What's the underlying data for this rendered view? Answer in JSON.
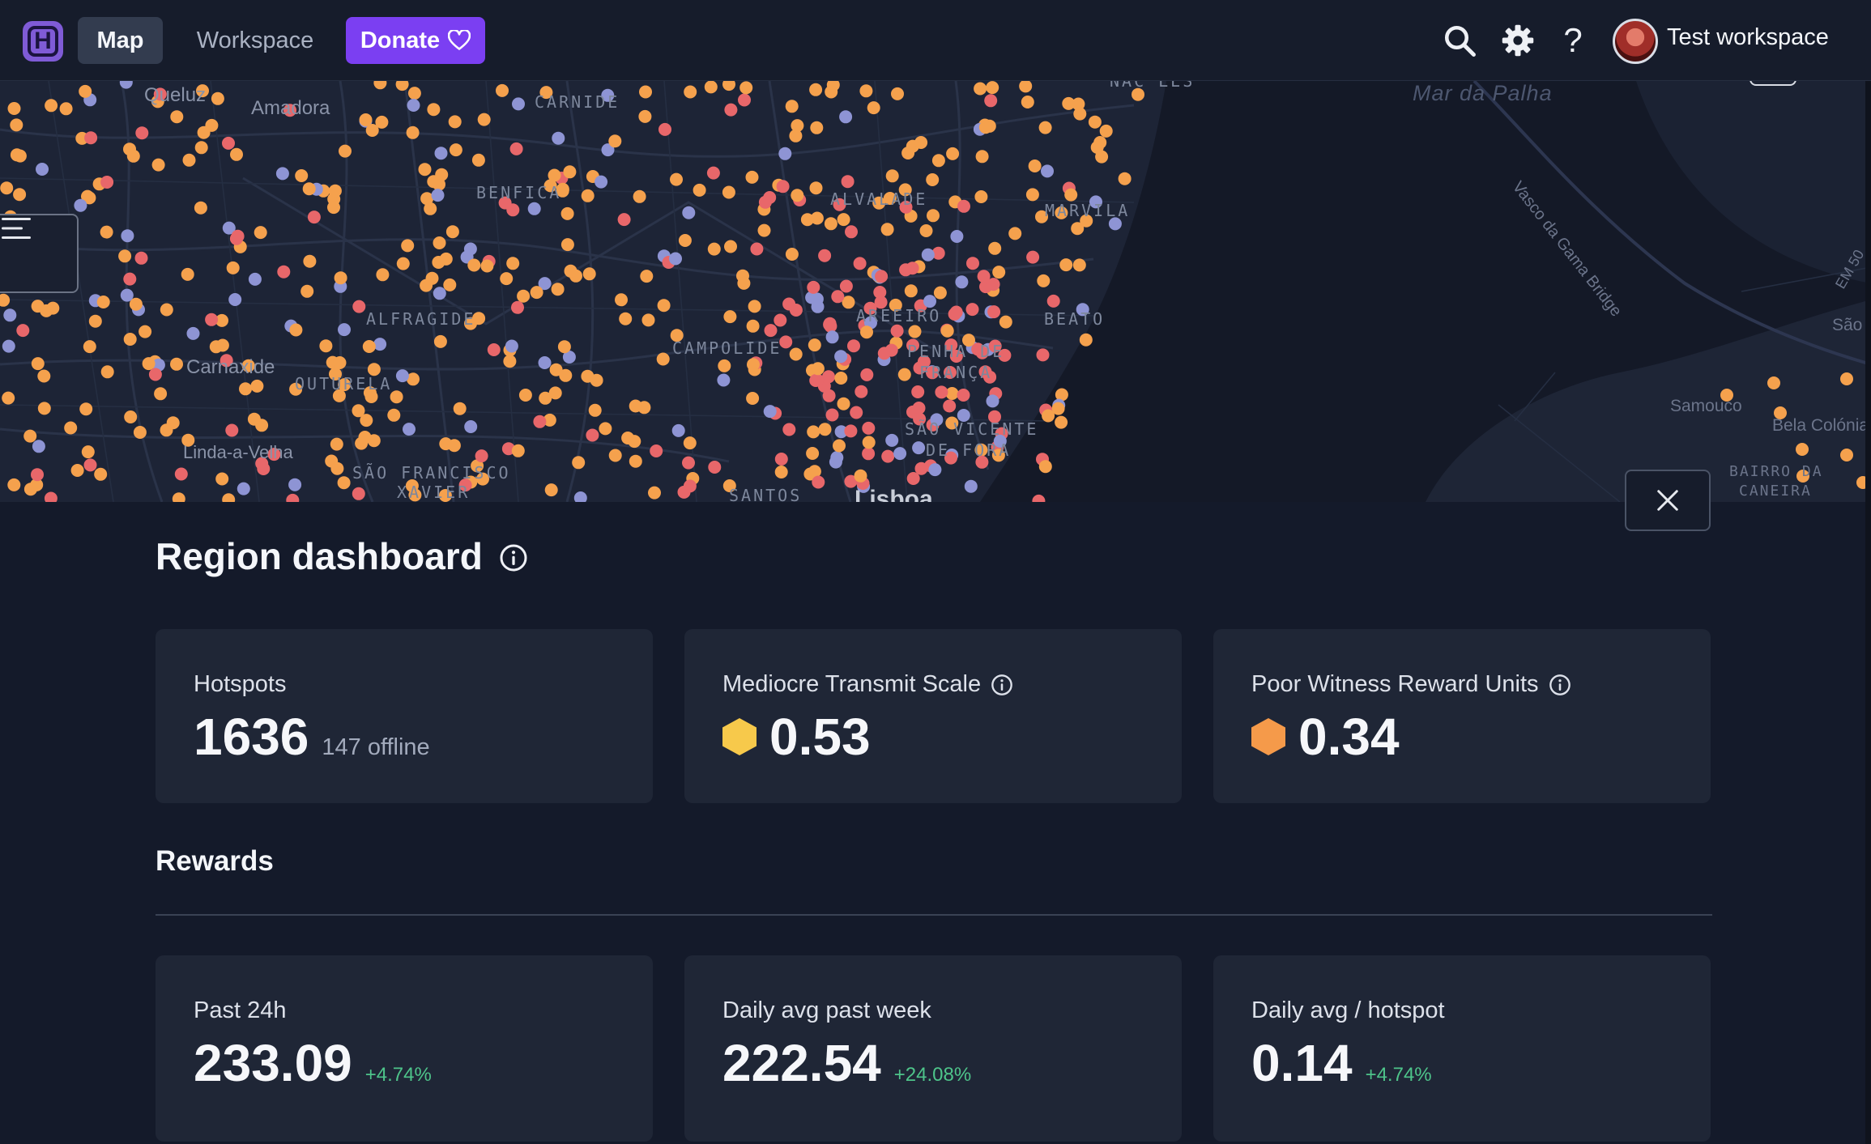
{
  "app": {
    "logo_letter": "H"
  },
  "nav": {
    "map_label": "Map",
    "workspace_label": "Workspace",
    "donate_label": "Donate"
  },
  "header": {
    "workspace_name": "Test workspace",
    "help_glyph": "?"
  },
  "icons": {
    "search": "search-icon",
    "settings": "gear-icon",
    "help": "question-icon",
    "donate": "heart-icon",
    "menu": "menu-icon",
    "close": "close-icon",
    "info": "info-icon"
  },
  "map": {
    "labels": {
      "queluz": "Queluz",
      "amadora": "Amadora",
      "carnide": "CARNIDE",
      "benfica": "BENFICA",
      "alvalade": "ALVALADE",
      "marvila": "MARVILA",
      "alfragide": "ALFRAGIDE",
      "areeiro": "AREEIRO",
      "beato": "BEATO",
      "campolide": "CAMPOLIDE",
      "penha": "PENHA DE",
      "franca": "FRANÇA",
      "carnaxide": "Carnaxide",
      "outurela": "OUTURELA",
      "sao_vicente": "SÃO VICENTE",
      "de_fora": "DE FORA",
      "linda": "Linda-a-Velha",
      "sao_francisco": "SÃO FRANCISCO",
      "xavier": "XAVIER",
      "santos": "SANTOS",
      "lisboa": "Lisboa",
      "mar_palha": "Mar da Palha",
      "vasco": "Vasco da Gama Bridge",
      "samouco": "Samouco",
      "bela_colonia": "Bela Colónia",
      "bairro": "BAIRRO DA",
      "caneira": "CANEIRA",
      "sao": "São",
      "em": "EM 50",
      "naoles": "NAC  LES"
    },
    "hotspot_colors": {
      "active": "#f5a14d",
      "warning": "#e8676a",
      "offline": "#8e94d4"
    }
  },
  "dashboard": {
    "title": "Region dashboard",
    "cards": {
      "hotspots": {
        "label": "Hotspots",
        "value": "1636",
        "sub": "147 offline"
      },
      "transmit": {
        "label": "Mediocre Transmit Scale",
        "value": "0.53",
        "hex_color": "#f7c94b"
      },
      "witness": {
        "label": "Poor Witness Reward Units",
        "value": "0.34",
        "hex_color": "#f59a4a"
      }
    },
    "rewards_title": "Rewards",
    "rewards": {
      "past24": {
        "label": "Past 24h",
        "value": "233.09",
        "delta": "+4.74%"
      },
      "week": {
        "label": "Daily avg past week",
        "value": "222.54",
        "delta": "+24.08%"
      },
      "per_hotspot": {
        "label": "Daily avg / hotspot",
        "value": "0.14",
        "delta": "+4.74%"
      }
    }
  }
}
